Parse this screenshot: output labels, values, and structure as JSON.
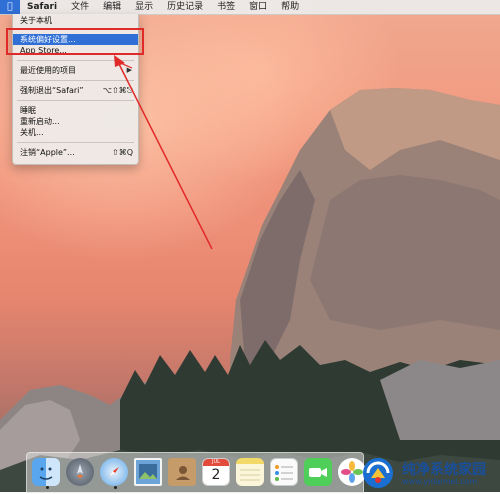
{
  "menubar": {
    "apple_icon": "apple-logo-icon",
    "items": [
      "Safari",
      "文件",
      "编辑",
      "显示",
      "历史记录",
      "书签",
      "窗口",
      "帮助"
    ]
  },
  "apple_menu": {
    "about": "关于本机",
    "system_prefs": "系统偏好设置...",
    "app_store": "App Store...",
    "recent_items": "最近使用的项目",
    "force_quit": "强制退出“Safari”",
    "force_quit_shortcut": "⌥⇧⌘⎋",
    "sleep": "睡眠",
    "restart": "重新启动...",
    "shutdown": "关机...",
    "logout": "注销“Apple”...",
    "logout_shortcut": "⇧⌘Q"
  },
  "dock": {
    "calendar_day": "2",
    "calendar_month": "JUL"
  },
  "watermark": {
    "title": "纯净系统家园",
    "url": "www.yidaimei.com"
  },
  "colors": {
    "highlight": "#2f6fd6",
    "annotation_red": "#e02a2a"
  }
}
